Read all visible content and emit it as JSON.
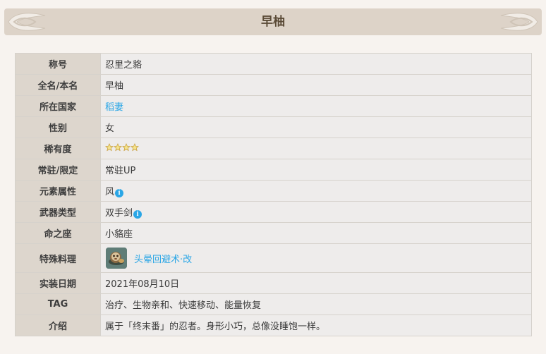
{
  "banner": {
    "title": "早柚"
  },
  "rows": {
    "title": {
      "label": "称号",
      "value": "忍里之貉"
    },
    "name": {
      "label": "全名/本名",
      "value": "早柚"
    },
    "nation": {
      "label": "所在国家",
      "value": "稻妻"
    },
    "gender": {
      "label": "性别",
      "value": "女"
    },
    "rarity": {
      "label": "稀有度",
      "stars": 4
    },
    "banner_type": {
      "label": "常驻/限定",
      "value": "常驻UP"
    },
    "element": {
      "label": "元素属性",
      "value": "风"
    },
    "weapon": {
      "label": "武器类型",
      "value": "双手剑"
    },
    "constellation": {
      "label": "命之座",
      "value": "小貉座"
    },
    "dish": {
      "label": "特殊料理",
      "value": "头晕回避术·改"
    },
    "release": {
      "label": "实装日期",
      "value": "2021年08月10日"
    },
    "tag": {
      "label": "TAG",
      "value": "治疗、生物亲和、快速移动、能量恢复"
    },
    "intro": {
      "label": "介绍",
      "value": "属于「终末番」的忍者。身形小巧，总像没睡饱一样。"
    }
  },
  "icons": {
    "info": "info-icon",
    "star": "star-icon",
    "dish": "dish-icon"
  },
  "colors": {
    "link": "#2aa6e6",
    "star_fill": "#f5e38a",
    "star_stroke": "#c8a245",
    "header_bg": "#ddd3c8",
    "label_bg": "#ddd6cd",
    "value_bg": "#eeeceb"
  },
  "info_glyph": "i"
}
